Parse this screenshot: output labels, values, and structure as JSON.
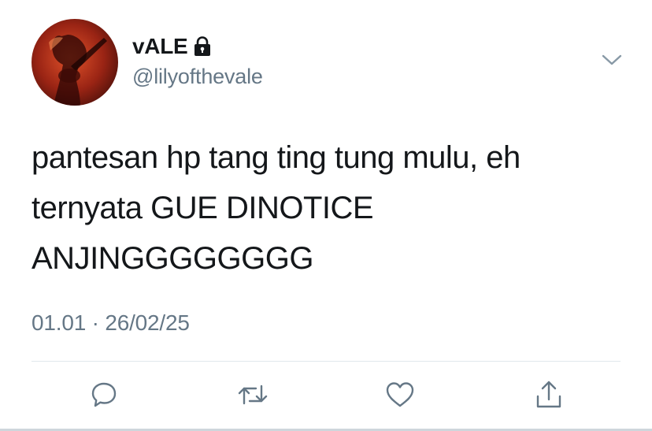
{
  "user": {
    "display_name": "vALE",
    "handle": "@lilyofthevale",
    "protected_icon": "lock-icon",
    "avatar": "profile-photo"
  },
  "tweet": {
    "lines": [
      "pantesan hp tang ting tung mulu, eh",
      "ternyata GUE DINOTICE",
      "ANJINGGGGGGGG"
    ],
    "timestamp": "01.01 · 26/02/25"
  },
  "actions": [
    {
      "icon": "reply-icon"
    },
    {
      "icon": "retweet-icon"
    },
    {
      "icon": "like-icon"
    },
    {
      "icon": "share-icon"
    }
  ],
  "colors": {
    "text": "#14171a",
    "secondary": "#657786",
    "divider": "#e1e8ed",
    "icon": "#657786"
  }
}
